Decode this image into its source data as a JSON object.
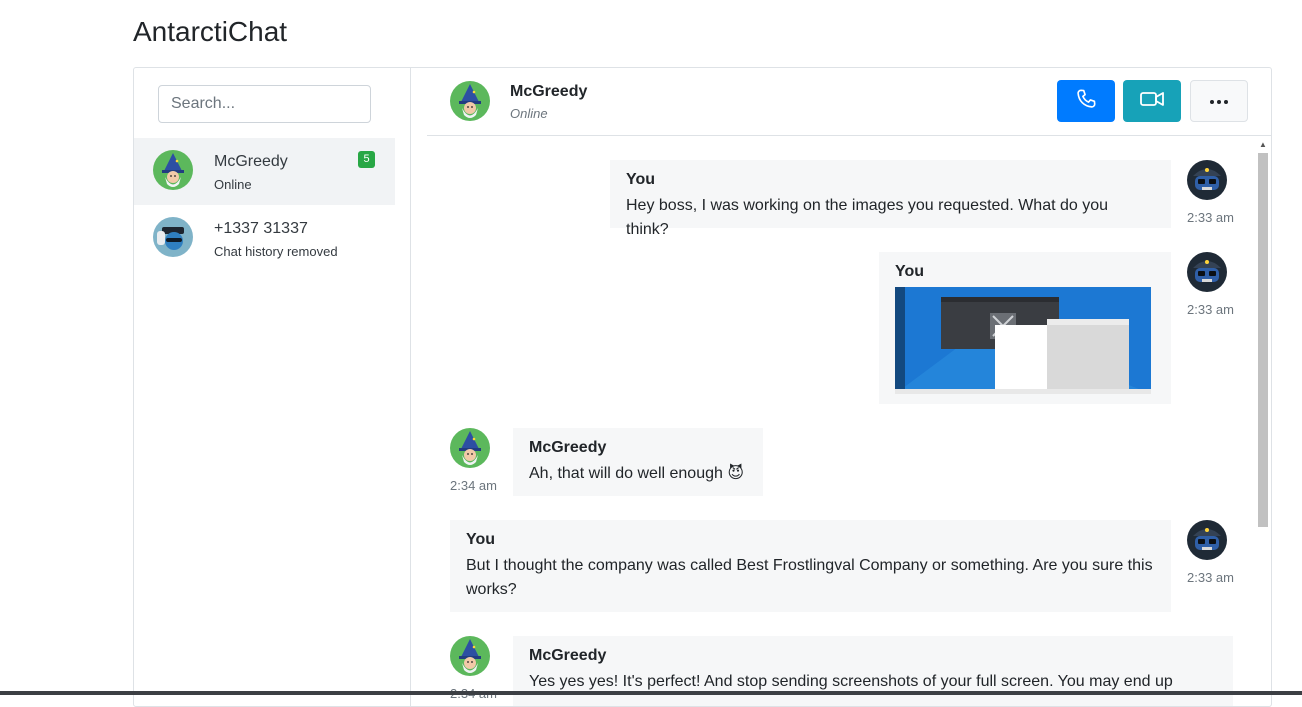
{
  "app": {
    "title": "AntarctiChat"
  },
  "sidebar": {
    "search_placeholder": "Search...",
    "contacts": [
      {
        "name": "McGreedy",
        "status": "Online",
        "unread": "5",
        "avatar": "wizard-avatar-icon"
      },
      {
        "name": "+1337 31337",
        "status": "Chat history removed",
        "avatar": "hacker-avatar-icon"
      }
    ]
  },
  "chat": {
    "header": {
      "name": "McGreedy",
      "status": "Online"
    },
    "actions": {
      "call": "phone-icon",
      "video": "video-camera-icon",
      "more": "more-options-icon"
    },
    "messages": [
      {
        "sender": "You",
        "text": "Hey boss, I was working on the images you requested. What do you think?",
        "time": "2:33 am"
      },
      {
        "sender": "You",
        "attachment": "screenshot-image",
        "time": "2:33 am"
      },
      {
        "sender": "McGreedy",
        "text": "Ah, that will do well enough 😈",
        "time": "2:34 am"
      },
      {
        "sender": "You",
        "text": "But I thought the company was called Best Frostlingval Company or something. Are you sure this works?",
        "time": "2:33 am"
      },
      {
        "sender": "McGreedy",
        "text": "Yes yes yes! It's perfect! And stop sending screenshots of your full screen. You may end up",
        "time": "2:34 am"
      }
    ]
  },
  "colors": {
    "primary": "#007bff",
    "info": "#17a2b8",
    "success": "#28a745",
    "bubble": "#f6f7f8"
  }
}
